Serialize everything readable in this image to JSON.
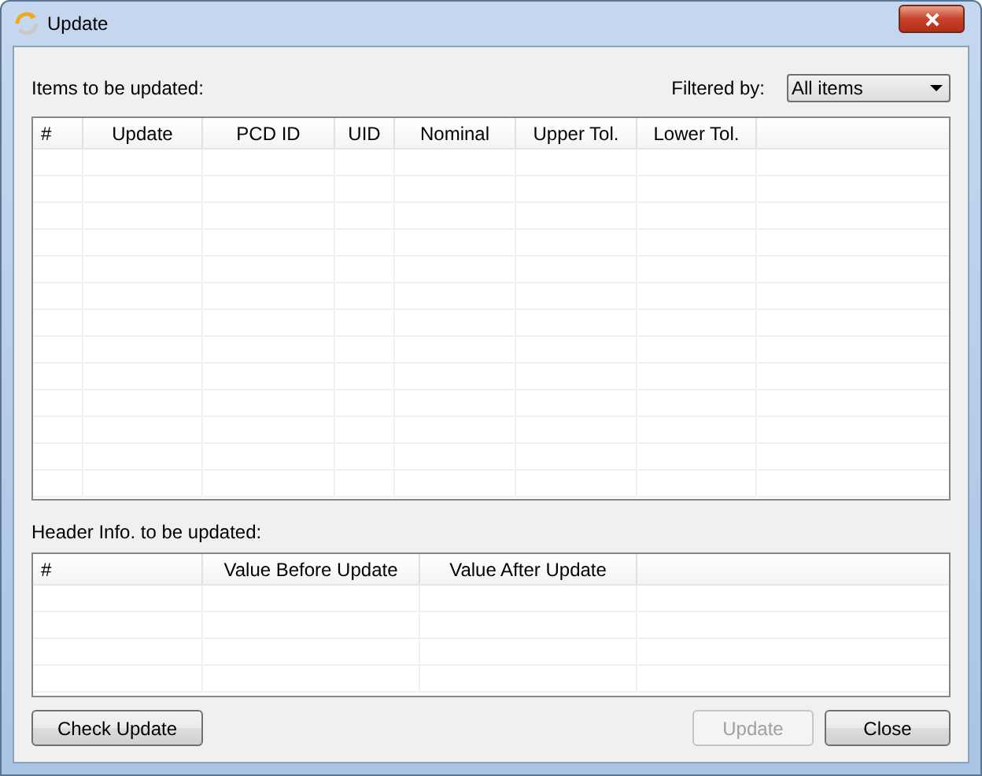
{
  "window": {
    "title": "Update"
  },
  "items_section": {
    "label": "Items to be updated:",
    "filter_label": "Filtered by:",
    "filter_value": "All items",
    "columns": [
      "#",
      "Update",
      "PCD ID",
      "UID",
      "Nominal",
      "Upper Tol.",
      "Lower Tol."
    ]
  },
  "header_section": {
    "label": "Header Info. to be updated:",
    "columns": [
      "#",
      "Value Before Update",
      "Value After Update"
    ]
  },
  "buttons": [
    {
      "label": "Check Update",
      "disabled": false
    },
    {
      "label": "Update",
      "disabled": true
    },
    {
      "label": "Close",
      "disabled": false
    }
  ]
}
